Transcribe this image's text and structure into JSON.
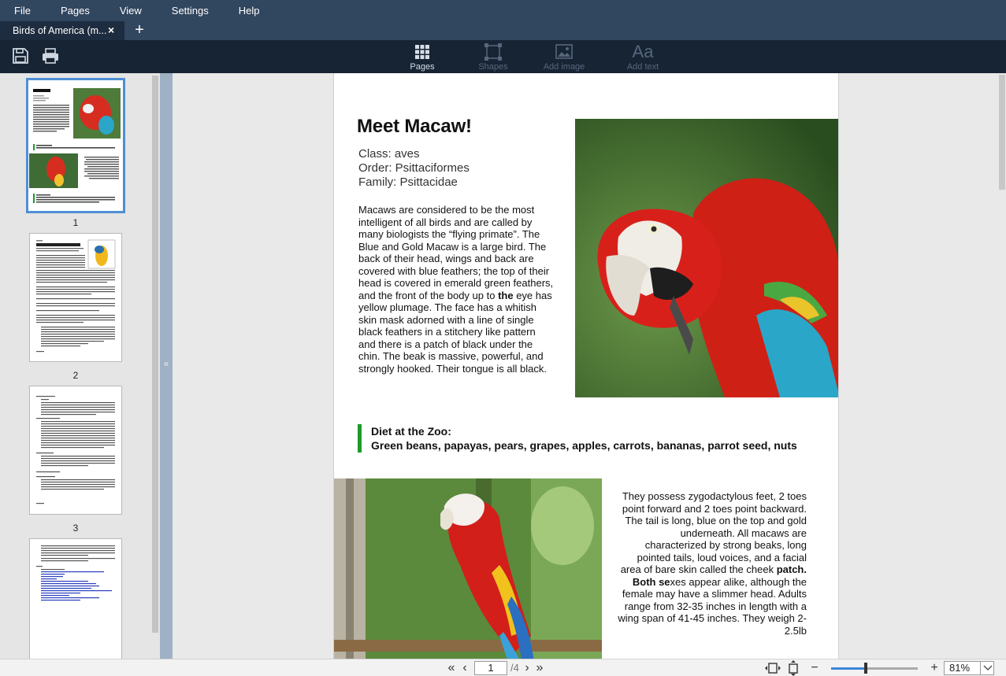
{
  "menu": {
    "items": [
      "File",
      "Pages",
      "View",
      "Settings",
      "Help"
    ]
  },
  "tabs": {
    "active_label": "Birds of America (m...",
    "close_glyph": "×",
    "add_glyph": "+"
  },
  "toolbar": {
    "tools": [
      {
        "label": "Pages",
        "icon": "grid-icon",
        "state": "active"
      },
      {
        "label": "Shapes",
        "icon": "shapes-icon",
        "state": "disabled"
      },
      {
        "label": "Add image",
        "icon": "image-icon",
        "state": "disabled"
      },
      {
        "label": "Add text",
        "icon": "text-icon",
        "glyph": "Aa",
        "state": "disabled"
      }
    ],
    "left_icons": [
      "save-icon",
      "print-icon"
    ]
  },
  "thumbnails": {
    "pages": [
      "1",
      "2",
      "3"
    ],
    "selected": "1"
  },
  "document": {
    "title": "Meet Macaw!",
    "class": "Class: aves",
    "order": "Order: Psittaciformes",
    "family": "Family: Psittacidae",
    "body1_a": "Macaws are considered to be the most intelligent of all birds and are called by many biologists the “flying primate”. The Blue and Gold Macaw is a large bird. The back of their head, wings and back are covered with blue feathers; the top of their head is covered in emerald green feathers, and the front of the body up to ",
    "body1_bold": "the",
    "body1_b": " eye has yellow plumage. The face has a whitish skin mask adorned with a line of single black feathers in a stitchery like pattern and there is a patch of black under the chin. The beak is massive, powerful, and strongly hooked. Their tongue is all black.",
    "diet_heading": "Diet at the Zoo:",
    "diet_list": "Green beans, papayas, pears, grapes, apples, carrots, bananas, parrot seed, nuts",
    "body2_a": "They possess zygodactylous feet, 2 toes point forward and 2 toes point backward. The tail is long, blue on the top and gold underneath. All macaws are characterized by strong beaks, long pointed tails, loud voices, and a facial area of bare skin called the cheek ",
    "body2_bold": "patch. Both se",
    "body2_b": "xes appear alike, although the female may have a slimmer head. Adults range from 32-35 inches in length with a wing span of 41-45 inches. They weigh 2-2.5lb"
  },
  "divider": {
    "collapse_glyph": "«"
  },
  "status": {
    "first_glyph": "«",
    "prev_glyph": "‹",
    "next_glyph": "›",
    "last_glyph": "»",
    "page_input": "1",
    "page_total": "/4",
    "zoom_minus": "−",
    "zoom_plus": "+",
    "zoom_value": "81%",
    "zoom_level": 0.4
  },
  "colors": {
    "menubar": "#31465f",
    "toolbar": "#172434",
    "accent": "#4f8fd6",
    "diet_bar": "#1e9a2b"
  }
}
